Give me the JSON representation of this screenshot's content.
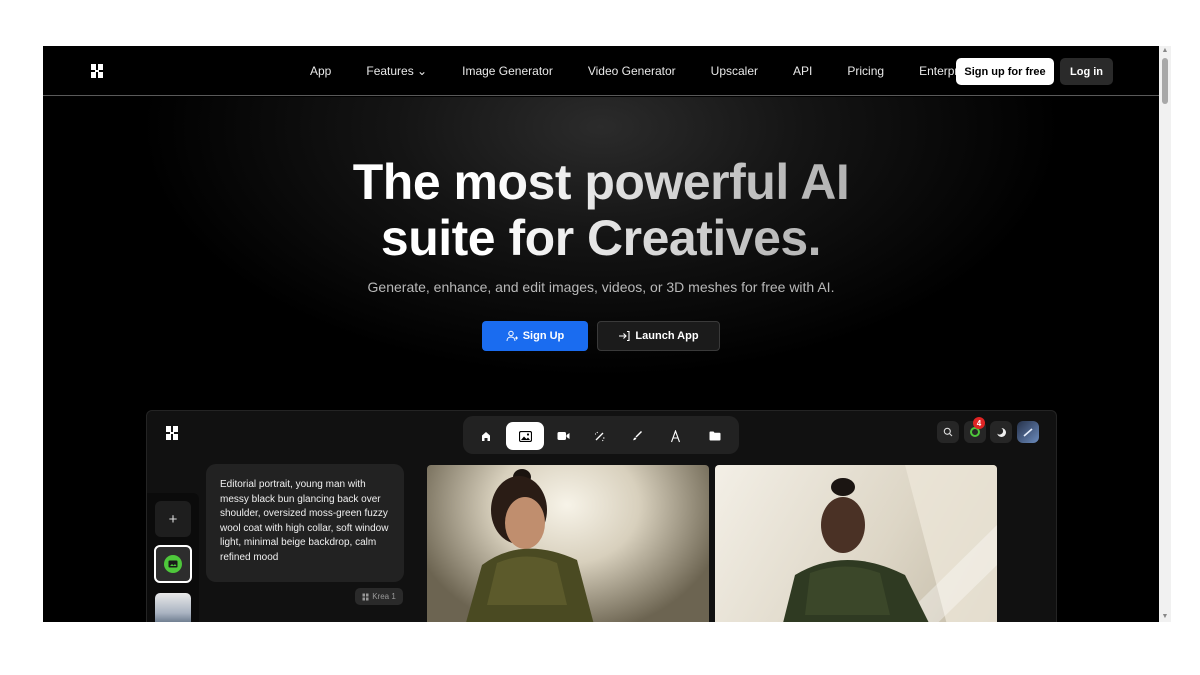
{
  "nav": {
    "links": [
      {
        "label": "App",
        "x": 0
      },
      {
        "label": "Features ⌄"
      },
      {
        "label": "Image Generator"
      },
      {
        "label": "Video Generator"
      },
      {
        "label": "Upscaler"
      },
      {
        "label": "API"
      },
      {
        "label": "Pricing"
      },
      {
        "label": "Enterprise"
      }
    ],
    "signup_label": "Sign up for free",
    "login_label": "Log in"
  },
  "hero": {
    "title_line1": "The most powerful AI",
    "title_line2": "suite for Creatives.",
    "subtitle": "Generate, enhance, and edit images, videos, or 3D meshes for free with AI.",
    "signup_button": "Sign Up",
    "launch_button": "Launch App"
  },
  "app_preview": {
    "toolbar_icons": [
      "home-icon",
      "image-icon",
      "video-icon",
      "enhance-icon",
      "edit-brush-icon",
      "text-3d-icon",
      "folder-icon"
    ],
    "active_tool": "image-icon",
    "notification_count": "4",
    "prompt_text": "Editorial portrait, young man with messy black bun glancing back over shoulder, oversized moss-green fuzzy wool coat with high collar, soft window light, minimal beige backdrop, calm refined mood",
    "model_label": "Krea 1",
    "add_button": "+"
  },
  "colors": {
    "accent_blue": "#1a6cf0",
    "background": "#000000",
    "badge_red": "#e02424",
    "status_green": "#4ec73b"
  }
}
